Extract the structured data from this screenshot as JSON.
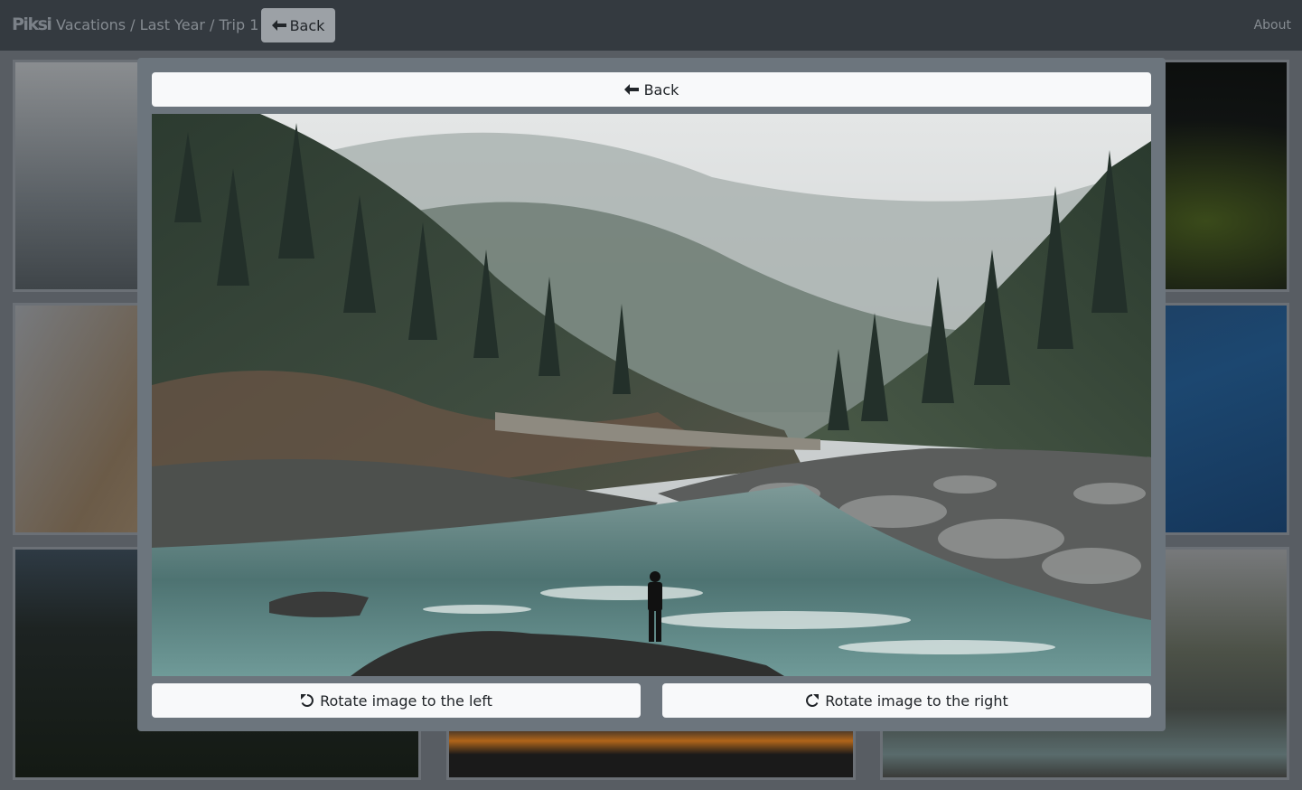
{
  "app": {
    "brand": "Piksi",
    "breadcrumb": "Vacations / Last Year / Trip 1",
    "back_label": "Back",
    "about_label": "About"
  },
  "modal": {
    "back_label": "Back",
    "rotate_left_label": "Rotate image to the left",
    "rotate_right_label": "Rotate image to the right"
  },
  "icons": {
    "back": "arrow-left-icon",
    "rotate_left": "rotate-left-icon",
    "rotate_right": "rotate-right-icon"
  }
}
